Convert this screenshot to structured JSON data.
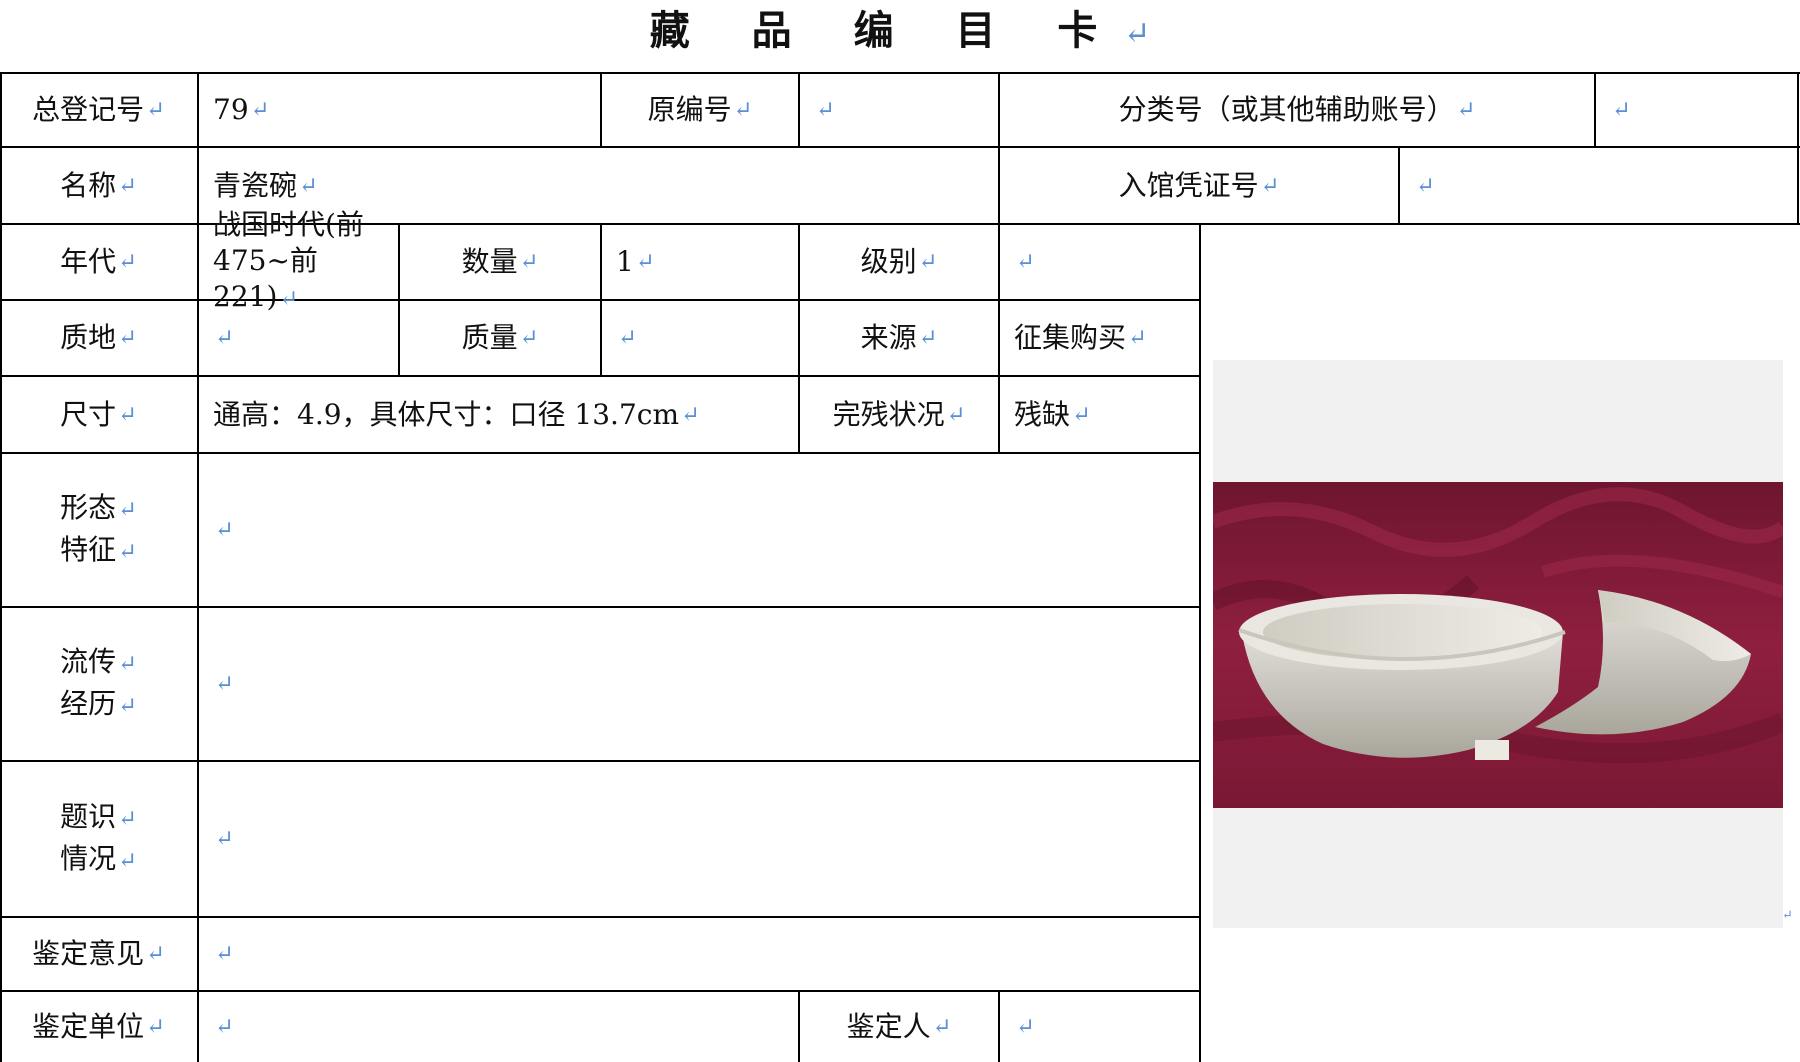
{
  "card": {
    "title": "藏 品 编 目 卡",
    "paragraph_mark": "↵"
  },
  "fields": {
    "total_reg_label": "总登记号",
    "total_reg_value": "79",
    "orig_num_label": "原编号",
    "orig_num_value": "",
    "class_num_label": "分类号（或其他辅助账号）",
    "class_num_value": "",
    "name_label": "名称",
    "name_value": "青瓷碗",
    "entry_cert_label": "入馆凭证号",
    "entry_cert_value": "",
    "era_label": "年代",
    "era_value_line1": "战国时代(前",
    "era_value_line2": "475~前 221)",
    "quantity_label": "数量",
    "quantity_value": "1",
    "level_label": "级别",
    "level_value": "",
    "material_label": "质地",
    "material_value": "",
    "weight_label": "质量",
    "weight_value": "",
    "source_label": "来源",
    "source_value": "征集购买",
    "size_label": "尺寸",
    "size_value": "通高：4.9，具体尺寸：口径 13.7cm",
    "condition_label": "完残状况",
    "condition_value": "残缺",
    "form_label_line1": "形态",
    "form_label_line2": "特征",
    "form_value": "",
    "history_label_line1": "流传",
    "history_label_line2": "经历",
    "history_value": "",
    "inscription_label_line1": "题识",
    "inscription_label_line2": "情况",
    "inscription_value": "",
    "appraisal_opinion_label": "鉴定意见",
    "appraisal_opinion_value": "",
    "appraisal_unit_label": "鉴定单位",
    "appraisal_unit_value": "",
    "appraiser_label": "鉴定人",
    "appraiser_value": ""
  },
  "photo": {
    "subject": "broken white celadon bowl on crimson velvet",
    "cloth_color": "#8a1c3c",
    "bowl_color": "#d9d6cc"
  }
}
